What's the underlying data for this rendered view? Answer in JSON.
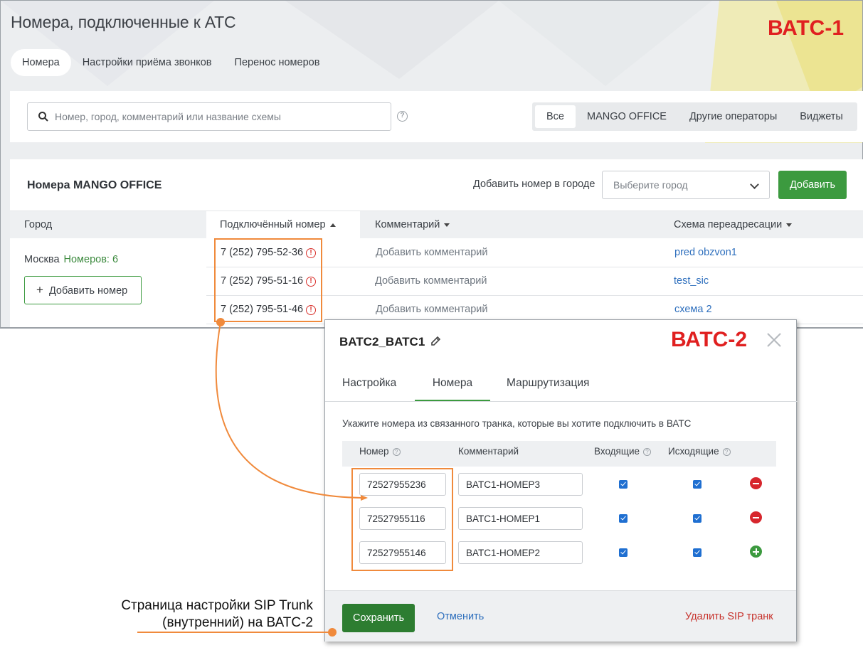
{
  "vats1": {
    "label": "ВАТС-1",
    "page_title": "Номера, подключенные к АТС",
    "tabs": [
      {
        "label": "Номера",
        "active": true
      },
      {
        "label": "Настройки приёма звонков",
        "active": false
      },
      {
        "label": "Перенос номеров",
        "active": false
      }
    ],
    "search": {
      "placeholder": "Номер, город, комментарий или название схемы",
      "help_icon": "?"
    },
    "filters": [
      {
        "label": "Все",
        "active": true
      },
      {
        "label": "MANGO OFFICE",
        "active": false
      },
      {
        "label": "Другие операторы",
        "active": false
      },
      {
        "label": "Виджеты",
        "active": false
      }
    ],
    "numbers_section": {
      "title": "Номера MANGO OFFICE",
      "add_city_label": "Добавить номер в городе",
      "city_select_placeholder": "Выберите город",
      "add_button": "Добавить",
      "columns": {
        "city": "Город",
        "number": "Подключённый номер",
        "comment": "Комментарий",
        "scheme": "Схема переадресации"
      },
      "city_name": "Москва",
      "city_count": "Номеров: 6",
      "add_number_button": "Добавить номер",
      "rows": [
        {
          "number": "7 (252) 795-52-36",
          "comment": "Добавить комментарий",
          "scheme": "pred obzvon1"
        },
        {
          "number": "7 (252) 795-51-16",
          "comment": "Добавить комментарий",
          "scheme": "test_sic"
        },
        {
          "number": "7 (252) 795-51-46",
          "comment": "Добавить комментарий",
          "scheme": "схема 2"
        }
      ]
    }
  },
  "vats2": {
    "label": "ВАТС-2",
    "title": "BATC2_BATC1",
    "tabs": [
      {
        "label": "Настройка",
        "active": false
      },
      {
        "label": "Номера",
        "active": true
      },
      {
        "label": "Маршрутизация",
        "active": false
      }
    ],
    "description": "Укажите номера из связанного транка, которые вы хотите подключить в ВАТС",
    "columns": {
      "number": "Номер",
      "comment": "Комментарий",
      "incoming": "Входящие",
      "outgoing": "Исходящие"
    },
    "rows": [
      {
        "number": "72527955236",
        "comment": "BATC1-HOMEP3",
        "incoming": true,
        "outgoing": true,
        "action": "remove"
      },
      {
        "number": "72527955116",
        "comment": "BATC1-HOMEP1",
        "incoming": true,
        "outgoing": true,
        "action": "remove"
      },
      {
        "number": "72527955146",
        "comment": "BATC1-HOMEP2",
        "incoming": true,
        "outgoing": true,
        "action": "add"
      }
    ],
    "footer": {
      "save": "Сохранить",
      "cancel": "Отменить",
      "delete": "Удалить SIP транк"
    }
  },
  "annotation": {
    "caption_line1": "Страница настройки SIP Trunk",
    "caption_line2": "(внутренний) на ВАТС-2"
  },
  "colors": {
    "highlight": "#f08a3c",
    "accent_green": "#3c9a3f",
    "label_red": "#e02020",
    "link_blue": "#2e6fbd"
  }
}
